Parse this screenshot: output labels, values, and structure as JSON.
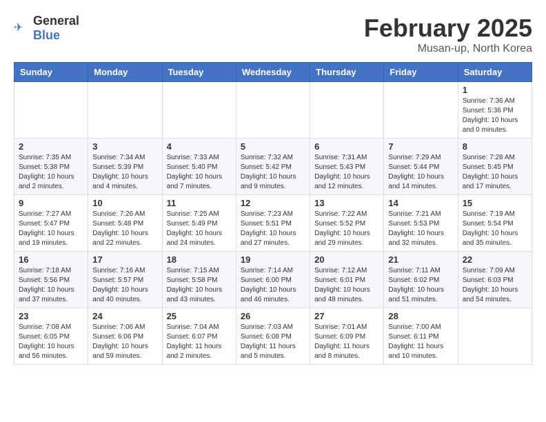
{
  "header": {
    "logo_general": "General",
    "logo_blue": "Blue",
    "month_year": "February 2025",
    "location": "Musan-up, North Korea"
  },
  "weekdays": [
    "Sunday",
    "Monday",
    "Tuesday",
    "Wednesday",
    "Thursday",
    "Friday",
    "Saturday"
  ],
  "weeks": [
    [
      {
        "day": "",
        "info": ""
      },
      {
        "day": "",
        "info": ""
      },
      {
        "day": "",
        "info": ""
      },
      {
        "day": "",
        "info": ""
      },
      {
        "day": "",
        "info": ""
      },
      {
        "day": "",
        "info": ""
      },
      {
        "day": "1",
        "info": "Sunrise: 7:36 AM\nSunset: 5:36 PM\nDaylight: 10 hours and 0 minutes."
      }
    ],
    [
      {
        "day": "2",
        "info": "Sunrise: 7:35 AM\nSunset: 5:38 PM\nDaylight: 10 hours and 2 minutes."
      },
      {
        "day": "3",
        "info": "Sunrise: 7:34 AM\nSunset: 5:39 PM\nDaylight: 10 hours and 4 minutes."
      },
      {
        "day": "4",
        "info": "Sunrise: 7:33 AM\nSunset: 5:40 PM\nDaylight: 10 hours and 7 minutes."
      },
      {
        "day": "5",
        "info": "Sunrise: 7:32 AM\nSunset: 5:42 PM\nDaylight: 10 hours and 9 minutes."
      },
      {
        "day": "6",
        "info": "Sunrise: 7:31 AM\nSunset: 5:43 PM\nDaylight: 10 hours and 12 minutes."
      },
      {
        "day": "7",
        "info": "Sunrise: 7:29 AM\nSunset: 5:44 PM\nDaylight: 10 hours and 14 minutes."
      },
      {
        "day": "8",
        "info": "Sunrise: 7:28 AM\nSunset: 5:45 PM\nDaylight: 10 hours and 17 minutes."
      }
    ],
    [
      {
        "day": "9",
        "info": "Sunrise: 7:27 AM\nSunset: 5:47 PM\nDaylight: 10 hours and 19 minutes."
      },
      {
        "day": "10",
        "info": "Sunrise: 7:26 AM\nSunset: 5:48 PM\nDaylight: 10 hours and 22 minutes."
      },
      {
        "day": "11",
        "info": "Sunrise: 7:25 AM\nSunset: 5:49 PM\nDaylight: 10 hours and 24 minutes."
      },
      {
        "day": "12",
        "info": "Sunrise: 7:23 AM\nSunset: 5:51 PM\nDaylight: 10 hours and 27 minutes."
      },
      {
        "day": "13",
        "info": "Sunrise: 7:22 AM\nSunset: 5:52 PM\nDaylight: 10 hours and 29 minutes."
      },
      {
        "day": "14",
        "info": "Sunrise: 7:21 AM\nSunset: 5:53 PM\nDaylight: 10 hours and 32 minutes."
      },
      {
        "day": "15",
        "info": "Sunrise: 7:19 AM\nSunset: 5:54 PM\nDaylight: 10 hours and 35 minutes."
      }
    ],
    [
      {
        "day": "16",
        "info": "Sunrise: 7:18 AM\nSunset: 5:56 PM\nDaylight: 10 hours and 37 minutes."
      },
      {
        "day": "17",
        "info": "Sunrise: 7:16 AM\nSunset: 5:57 PM\nDaylight: 10 hours and 40 minutes."
      },
      {
        "day": "18",
        "info": "Sunrise: 7:15 AM\nSunset: 5:58 PM\nDaylight: 10 hours and 43 minutes."
      },
      {
        "day": "19",
        "info": "Sunrise: 7:14 AM\nSunset: 6:00 PM\nDaylight: 10 hours and 46 minutes."
      },
      {
        "day": "20",
        "info": "Sunrise: 7:12 AM\nSunset: 6:01 PM\nDaylight: 10 hours and 48 minutes."
      },
      {
        "day": "21",
        "info": "Sunrise: 7:11 AM\nSunset: 6:02 PM\nDaylight: 10 hours and 51 minutes."
      },
      {
        "day": "22",
        "info": "Sunrise: 7:09 AM\nSunset: 6:03 PM\nDaylight: 10 hours and 54 minutes."
      }
    ],
    [
      {
        "day": "23",
        "info": "Sunrise: 7:08 AM\nSunset: 6:05 PM\nDaylight: 10 hours and 56 minutes."
      },
      {
        "day": "24",
        "info": "Sunrise: 7:06 AM\nSunset: 6:06 PM\nDaylight: 10 hours and 59 minutes."
      },
      {
        "day": "25",
        "info": "Sunrise: 7:04 AM\nSunset: 6:07 PM\nDaylight: 11 hours and 2 minutes."
      },
      {
        "day": "26",
        "info": "Sunrise: 7:03 AM\nSunset: 6:08 PM\nDaylight: 11 hours and 5 minutes."
      },
      {
        "day": "27",
        "info": "Sunrise: 7:01 AM\nSunset: 6:09 PM\nDaylight: 11 hours and 8 minutes."
      },
      {
        "day": "28",
        "info": "Sunrise: 7:00 AM\nSunset: 6:11 PM\nDaylight: 11 hours and 10 minutes."
      },
      {
        "day": "",
        "info": ""
      }
    ]
  ]
}
